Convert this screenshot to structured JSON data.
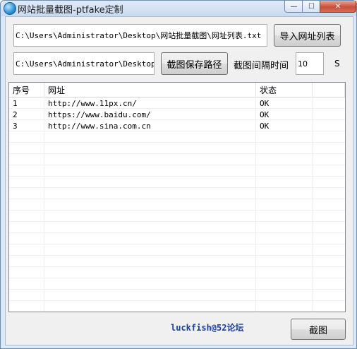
{
  "window": {
    "title": "网站批量截图-ptfake定制",
    "controls": {
      "minimize": "—",
      "maximize": "☐",
      "close": "✕"
    }
  },
  "url_list_path": "C:\\Users\\Administrator\\Desktop\\网站批量截图\\网址列表.txt",
  "import_button": "导入网址列表",
  "save_path": "C:\\Users\\Administrator\\Desktop",
  "save_path_button": "截图保存路径",
  "interval_label": "截图间隔时间",
  "interval_value": "10",
  "interval_unit": "S",
  "table": {
    "headers": [
      "序号",
      "网址",
      "状态",
      ""
    ],
    "rows": [
      [
        "1",
        "http://www.11px.cn/",
        "OK"
      ],
      [
        "2",
        "https://www.baidu.com/",
        "OK"
      ],
      [
        "3",
        "http://www.sina.com.cn",
        "OK"
      ]
    ],
    "empty_row_count": 15
  },
  "footer_credit": "luckfish@52论坛",
  "screenshot_button": "截图"
}
